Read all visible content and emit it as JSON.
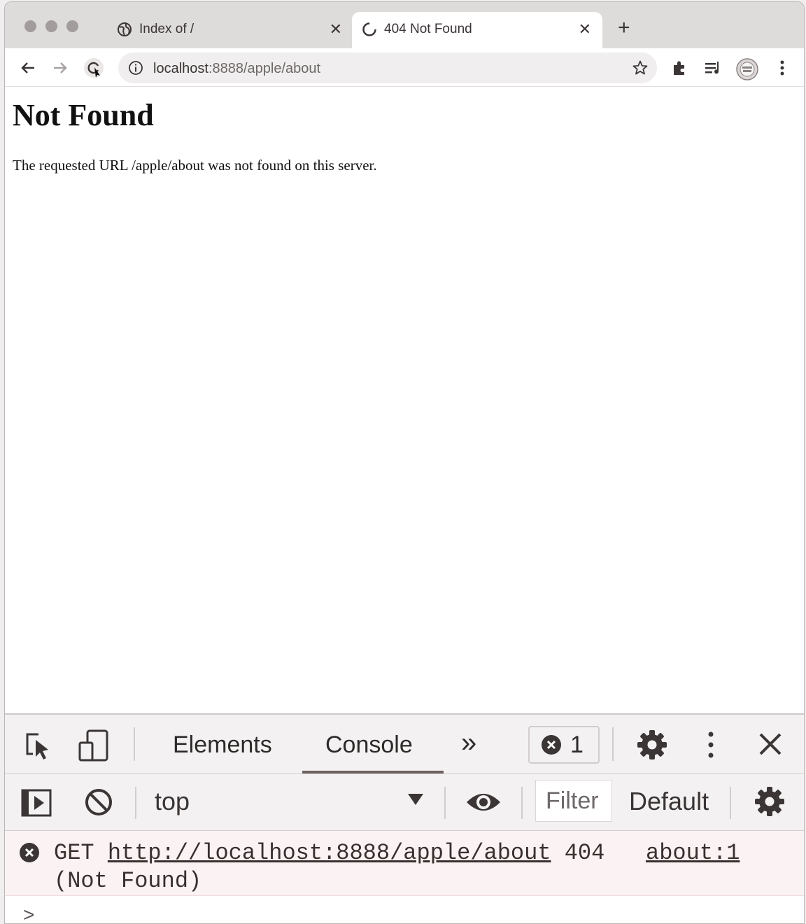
{
  "tabs": [
    {
      "title": "Index of /",
      "icon": "globe-icon",
      "active": false
    },
    {
      "title": "404 Not Found",
      "icon": "loading-icon",
      "active": true
    }
  ],
  "toolbar": {
    "url_host": "localhost",
    "url_path": ":8888/apple/about"
  },
  "page": {
    "heading": "Not Found",
    "message": "The requested URL /apple/about was not found on this server."
  },
  "devtools": {
    "tabs": [
      "Elements",
      "Console"
    ],
    "active_tab": "Console",
    "more_tabs": "»",
    "error_count": "1",
    "context": "top",
    "filter_placeholder": "Filter",
    "levels": "Default",
    "console": {
      "method": "GET",
      "url": "http://localhost:8888/apple/about",
      "status": "404",
      "status_text": "(Not Found)",
      "source": "about:1"
    },
    "prompt": ">"
  },
  "colors": {
    "tabstrip": "#dedbdb",
    "error_bg": "#fbf3f3",
    "text": "#3a3434"
  }
}
